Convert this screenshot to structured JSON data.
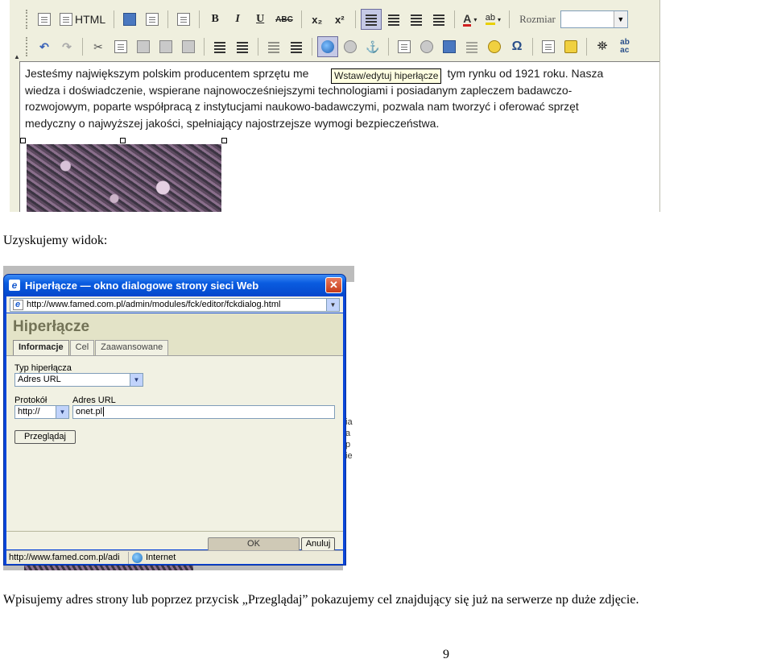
{
  "editor": {
    "toolbar_row1": {
      "html_label": "HTML",
      "bold_label": "B",
      "italic_label": "I",
      "underline_label": "U",
      "strike_label": "ABC",
      "subscript_label": "x₂",
      "superscript_label": "x²",
      "text_color_label": "A",
      "bg_color_label": "ab",
      "size_label": "Rozmiar",
      "size_value": ""
    },
    "tooltip": "Wstaw/edytuj hiperłącze",
    "content_lines": [
      "Jesteśmy największym polskim producentem sprzętu me",
      "tym rynku od 1921 roku. Nasza",
      "wiedza i doświadczenie, wspierane najnowocześniejszymi technologiami i posiadanym zapleczem badawczo-",
      "rozwojowym, poparte współpracą z instytucjami naukowo-badawczymi, pozwala nam tworzyć i oferować sprzęt",
      "medyczny o najwyższej jakości, spełniający najostrzejsze wymogi bezpieczeństwa."
    ]
  },
  "caption1": "Uzyskujemy widok:",
  "dialog": {
    "window_title": "Hiperłącze — okno dialogowe strony sieci Web",
    "close_symbol": "✕",
    "address_url": "http://www.famed.com.pl/admin/modules/fck/editor/fckdialog.html",
    "title": "Hiperłącze",
    "tabs": [
      "Informacje",
      "Cel",
      "Zaawansowane"
    ],
    "link_type_label": "Typ hiperłącza",
    "link_type_value": "Adres URL",
    "protocol_label": "Protokół",
    "protocol_value": "http://",
    "url_label": "Adres URL",
    "url_value": "onet.pl",
    "browse_button": "Przeglądaj",
    "ok_button": "OK",
    "cancel_button": "Anuluj",
    "status_url": "http://www.famed.com.pl/adi",
    "status_zone": "Internet"
  },
  "background_chars": [
    "ia",
    "a",
    "p",
    "ie"
  ],
  "caption2": "Wpisujemy adres strony lub poprzez przycisk „Przeglądaj” pokazujemy cel znajdujący się już na serwerze np duże zdjęcie.",
  "page_number": "9"
}
